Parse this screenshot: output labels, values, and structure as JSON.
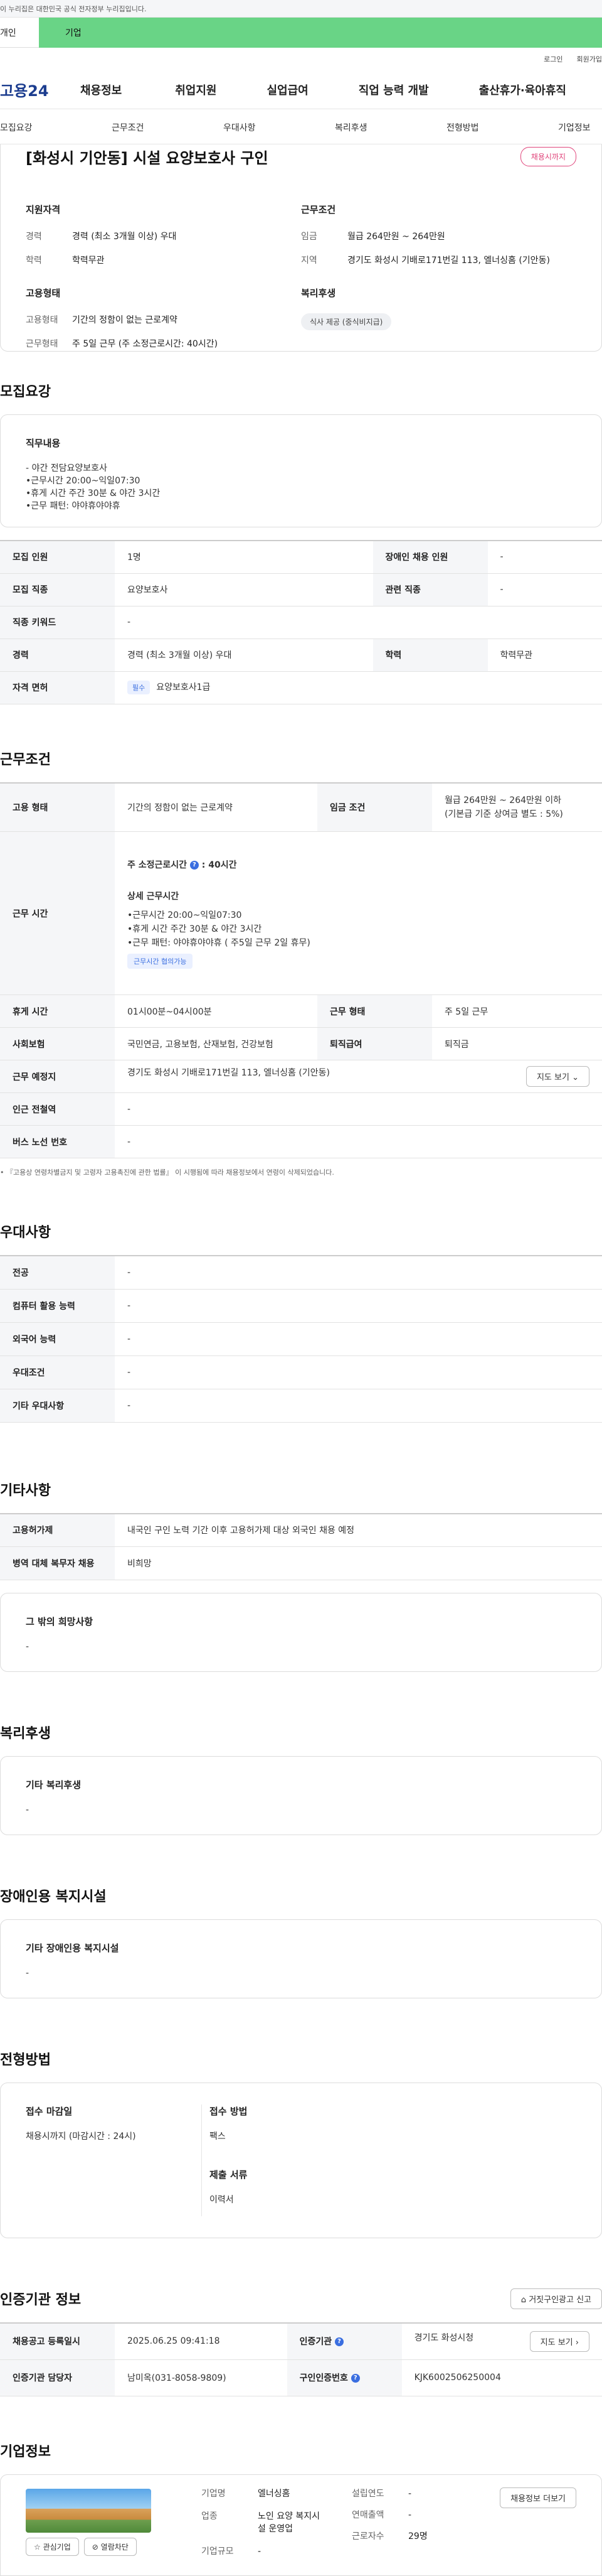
{
  "gov_banner": "이 누리집은 대한민국 공식 전자정부 누리집입니다.",
  "service_tabs": {
    "individual": "개인",
    "company": "기업"
  },
  "util": {
    "login": "로그인",
    "join": "회원가입"
  },
  "logo": "고용24",
  "gnb": [
    "채용정보",
    "취업지원",
    "실업급여",
    "직업 능력 개발",
    "출산휴가·육아휴직"
  ],
  "anchors": [
    "모집요강",
    "근무조건",
    "우대사항",
    "복리후생",
    "전형방법",
    "기업정보"
  ],
  "job": {
    "title": "[화성시 기안동] 시설 요양보호사 구인",
    "badge": "채용시까지",
    "summary": {
      "qual_h": "지원자격",
      "qual": [
        {
          "k": "경력",
          "v": "경력 (최소 3개월 이상) 우대"
        },
        {
          "k": "학력",
          "v": "학력무관"
        }
      ],
      "emp_h": "고용형태",
      "emp": [
        {
          "k": "고용형태",
          "v": "기간의 정함이 없는 근로계약"
        },
        {
          "k": "근무형태",
          "v": "주 5일 근무 (주 소정근로시간: 40시간)"
        }
      ],
      "cond_h": "근무조건",
      "cond": [
        {
          "k": "임금",
          "v": "월급 264만원 ~ 264만원"
        },
        {
          "k": "지역",
          "v": "경기도 화성시 기배로171번길 113, 엘너싱홈 (기안동)"
        }
      ],
      "welfare_h": "복리후생",
      "welfare_chip": "식사 제공 (중식비지급)"
    }
  },
  "recruit": {
    "title": "모집요강",
    "duty_h": "직무내용",
    "duty_lines": [
      "- 야간 전담요양보호사",
      "•근무시간 20:00~익일07:30",
      "•휴게 시간 주간 30분 & 야간 3시간",
      "•근무 패턴: 야야휴야야휴"
    ],
    "rows": {
      "headcount_k": "모집 인원",
      "headcount_v": "1명",
      "disabled_k": "장애인 채용 인원",
      "disabled_v": "-",
      "job_k": "모집 직종",
      "job_v": "요양보호사",
      "related_k": "관련 직종",
      "related_v": "-",
      "keyword_k": "직종 키워드",
      "keyword_v": "-",
      "career_k": "경력",
      "career_v": "경력 (최소 3개월 이상) 우대",
      "edu_k": "학력",
      "edu_v": "학력무관",
      "license_k": "자격 면허",
      "license_tag": "필수",
      "license_v": "요양보호사1급"
    }
  },
  "work": {
    "title": "근무조건",
    "emp_k": "고용 형태",
    "emp_v": "기간의 정함이 없는 근로계약",
    "wage_k": "임금 조건",
    "wage_v1": "월급 264만원 ~ 264만원 이하",
    "wage_v2": "(기본급 기준 상여금 별도 : 5%)",
    "hours_k": "근무 시간",
    "hours_main": "주 소정근로시간",
    "hours_main_v": ": 40시간",
    "hours_detail_h": "상세 근무시간",
    "hours_lines": [
      "•근무시간 20:00~익일07:30",
      "•휴게 시간 주간 30분 & 야간 3시간",
      "•근무 패턴: 야야휴야야휴 ( 주5일 근무 2일 휴무)"
    ],
    "hours_tag": "근무시간 협의가능",
    "break_k": "휴게 시간",
    "break_v": "01시00분~04시00분",
    "type_k": "근무 형태",
    "type_v": "주 5일 근무",
    "ins_k": "사회보험",
    "ins_v": "국민연금, 고용보험, 산재보험, 건강보험",
    "sev_k": "퇴직급여",
    "sev_v": "퇴직금",
    "loc_k": "근무 예정지",
    "loc_v": "경기도 화성시 기배로171번길 113, 엘너싱홈 (기안동)",
    "map_btn": "지도 보기",
    "subway_k": "인근 전철역",
    "subway_v": "-",
    "bus_k": "버스 노선 번호",
    "bus_v": "-",
    "note": "• 『고용상 연령차별금지 및 고령자 고용촉진에 관한 법률』 이 시행됨에 따라 채용정보에서 연령이 삭제되었습니다."
  },
  "pref": {
    "title": "우대사항",
    "rows": [
      {
        "k": "전공",
        "v": "-"
      },
      {
        "k": "컴퓨터 활용 능력",
        "v": "-"
      },
      {
        "k": "외국어 능력",
        "v": "-"
      },
      {
        "k": "우대조건",
        "v": "-"
      },
      {
        "k": "기타 우대사항",
        "v": "-"
      }
    ]
  },
  "etc": {
    "title": "기타사항",
    "rows": [
      {
        "k": "고용허가제",
        "v": "내국인 구인 노력 기간 이후 고용허가제 대상 외국인 채용 예정"
      },
      {
        "k": "병역 대체 복무자 채용",
        "v": "비희망"
      }
    ],
    "other_h": "그 밖의 희망사항",
    "other_v": "-"
  },
  "welfare": {
    "title": "복리후생",
    "h": "기타 복리후생",
    "v": "-"
  },
  "disabled": {
    "title": "장애인용 복지시설",
    "h": "기타 장애인용 복지시설",
    "v": "-"
  },
  "selection": {
    "title": "전형방법",
    "deadline_h": "접수 마감일",
    "deadline_v": "채용시까지 (마감시간 : 24시)",
    "method_h": "접수 방법",
    "method_v": "팩스",
    "docs_h": "제출 서류",
    "docs_v": "이력서"
  },
  "cert": {
    "title": "인증기관 정보",
    "report_btn": "거짓구인광고 신고",
    "reg_k": "채용공고 등록일시",
    "reg_v": "2025.06.25 09:41:18",
    "agency_k": "인증기관",
    "agency_v": "경기도 화성시청",
    "map_btn": "지도 보기",
    "manager_k": "인증기관 담당자",
    "manager_v": "남미옥(031-8058-9809)",
    "id_k": "구인인증번호",
    "id_v": "KJK6002506250004"
  },
  "company": {
    "title": "기업정보",
    "name_k": "기업명",
    "name_v": "엘너싱홈",
    "ind_k": "업종",
    "ind_v1": "노인 요양 복지시",
    "ind_v2": "설 운영업",
    "size_k": "기업규모",
    "size_v": "-",
    "year_k": "설립연도",
    "year_v": "-",
    "sales_k": "연매출액",
    "sales_v": "-",
    "emp_k": "근로자수",
    "emp_v": "29명",
    "like_btn": "관심기업",
    "block_btn": "열람차단",
    "more_btn": "채용정보 더보기"
  }
}
